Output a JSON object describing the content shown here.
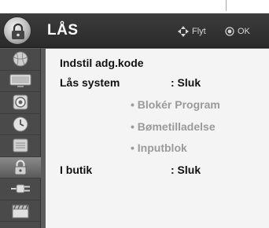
{
  "header": {
    "title": "LÅS",
    "move_hint": "Flyt",
    "ok_hint": "OK"
  },
  "sidebar": {
    "items": [
      {
        "icon": "globe-icon"
      },
      {
        "icon": "tv-screen-icon"
      },
      {
        "icon": "speaker-icon"
      },
      {
        "icon": "clock-icon"
      },
      {
        "icon": "menu-list-icon"
      },
      {
        "icon": "padlock-icon",
        "active": true
      },
      {
        "icon": "plug-icon"
      },
      {
        "icon": "clapper-icon"
      }
    ]
  },
  "menu": {
    "set_password": "Indstil adg.kode",
    "lock_system_label": "Lås system",
    "lock_system_value": ": Sluk",
    "block_program": "• Blokér Program",
    "parental_guidance": "• Bømetilladelse",
    "input_block": "• Inputblok",
    "in_store_label": "I butik",
    "in_store_value": ": Sluk"
  },
  "colors": {
    "header_bg": "#2e2e2e",
    "panel_bg": "#f4f4f4",
    "sidebar_bg": "#4a4a4a",
    "disabled_text": "#9a9a9a"
  }
}
